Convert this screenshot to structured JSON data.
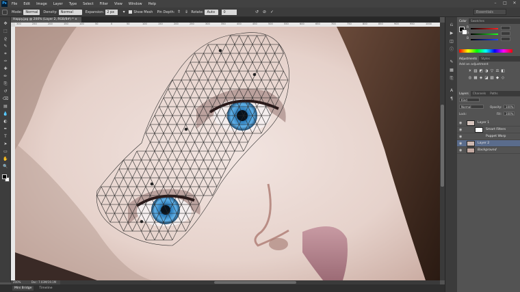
{
  "app": {
    "logo": "Ps",
    "menu": [
      "File",
      "Edit",
      "Image",
      "Layer",
      "Type",
      "Select",
      "Filter",
      "View",
      "Window",
      "Help"
    ],
    "window_controls": [
      "–",
      "□",
      "✕"
    ]
  },
  "options_bar": {
    "mode_label": "Mode:",
    "mode_value": "Normal",
    "density_label": "Density:",
    "density_value": "Normal",
    "expansion_label": "Expansion:",
    "expansion_value": "2 px",
    "show_mesh_label": "Show Mesh",
    "pin_depth_label": "Pin Depth:",
    "rotate_label": "Rotate:",
    "rotate_value": "Auto",
    "rotate_angle": "0",
    "workspace": "Essentials"
  },
  "document": {
    "tab_title": "Happy.jpg @ 200% (Layer 2, RGB/8#) *",
    "ruler_ticks": [
      "300",
      "250",
      "200",
      "150",
      "100",
      "50",
      "0",
      "50",
      "100",
      "150",
      "200",
      "250",
      "300",
      "350",
      "400",
      "450",
      "500",
      "550",
      "600",
      "650",
      "700",
      "750",
      "800",
      "850",
      "900",
      "950",
      "1000"
    ]
  },
  "status": {
    "zoom": "200%",
    "doc_info": "Doc: 7.03M/19.1M"
  },
  "bottom_tabs": [
    "Mini Bridge",
    "Timeline"
  ],
  "toolbar": {
    "tools": [
      "move-tool-icon",
      "marquee-tool-icon",
      "lasso-tool-icon",
      "quick-select-tool-icon",
      "crop-tool-icon",
      "eyedropper-tool-icon",
      "healing-tool-icon",
      "brush-tool-icon",
      "clone-stamp-tool-icon",
      "history-brush-tool-icon",
      "eraser-tool-icon",
      "gradient-tool-icon",
      "blur-tool-icon",
      "dodge-tool-icon",
      "pen-tool-icon",
      "type-tool-icon",
      "path-select-tool-icon",
      "shape-tool-icon",
      "hand-tool-icon",
      "zoom-tool-icon"
    ],
    "glyphs": [
      "✥",
      "⬚",
      "ϱ",
      "✎",
      "⌗",
      "✑",
      "✚",
      "✏",
      "⎘",
      "↺",
      "⌫",
      "▤",
      "💧",
      "◐",
      "✒",
      "T",
      "➤",
      "▭",
      "✋",
      "🔍"
    ]
  },
  "panels": {
    "color": {
      "tabs": [
        "Color",
        "Swatches"
      ],
      "channels": [
        "R",
        "G",
        "B"
      ],
      "channel_colors": [
        "#d43030",
        "#30b030",
        "#3050d0"
      ]
    },
    "adjustments": {
      "tabs": [
        "Adjustments",
        "Styles"
      ],
      "hint": "Add an adjustment",
      "icons": [
        "☀",
        "▥",
        "◩",
        "◑",
        "▽",
        "⚖",
        "◧",
        "◎",
        "▦",
        "◈",
        "◪",
        "▧",
        "◆",
        "◇"
      ]
    },
    "layers": {
      "tabs": [
        "Layers",
        "Channels",
        "Paths"
      ],
      "kind_label": "Kind",
      "blend_mode": "Normal",
      "opacity_label": "Opacity:",
      "opacity_value": "100%",
      "lock_label": "Lock:",
      "fill_label": "Fill:",
      "fill_value": "100%",
      "rows": [
        {
          "name": "Layer 1",
          "indent": 0,
          "selected": false
        },
        {
          "name": "Smart Filters",
          "indent": 1,
          "selected": false
        },
        {
          "name": "Puppet Warp",
          "indent": 2,
          "selected": false
        },
        {
          "name": "Layer 2",
          "indent": 0,
          "selected": true
        },
        {
          "name": "Background",
          "indent": 0,
          "selected": false
        }
      ]
    }
  }
}
